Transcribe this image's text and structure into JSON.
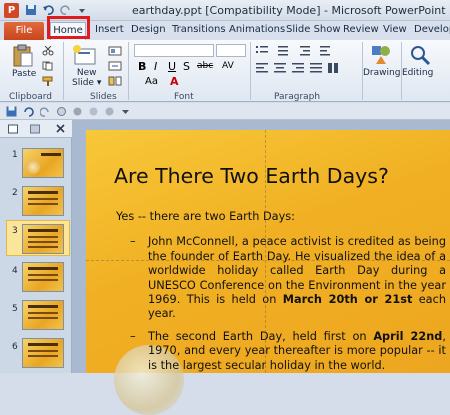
{
  "window": {
    "title": "earthday.ppt [Compatibility Mode] - Microsoft PowerPoint",
    "app_icon_letter": "P"
  },
  "tabs": {
    "file": "File",
    "items": [
      "Home",
      "Insert",
      "Design",
      "Transitions",
      "Animations",
      "Slide Show",
      "Review",
      "View",
      "Develope"
    ]
  },
  "ribbon": {
    "clipboard": {
      "paste": "Paste",
      "label": "Clipboard"
    },
    "slides": {
      "new_slide": "New Slide ▾",
      "new_slide_line1": "New",
      "new_slide_line2": "Slide ▾",
      "label": "Slides"
    },
    "font": {
      "bold": "B",
      "italic": "I",
      "underline": "U",
      "strike": "S",
      "shadow": "abc",
      "spacing": "AV",
      "case": "Aa",
      "color": "A",
      "label": "Font"
    },
    "paragraph": {
      "label": "Paragraph"
    },
    "drawing": {
      "label": "Drawing"
    },
    "editing": {
      "label": "Editing"
    }
  },
  "slide_panel": {
    "thumbnails": [
      "1",
      "2",
      "3",
      "4",
      "5",
      "6"
    ],
    "selected": "3"
  },
  "slide": {
    "title": "Are There Two Earth Days?",
    "bullet1": "Yes -- there are two Earth Days:",
    "sub1_part1": "John McConnell, a peace activist is credited as being the founder of Earth Day. He visualized the idea of a worldwide holiday called Earth Day during a UNESCO Conference on the Environment in the year 1969. This is held on ",
    "sub1_bold": "March 20th or 21st",
    "sub1_part2": " each year.",
    "sub2_part1": "The second Earth Day, held first on ",
    "sub2_bold": "April 22nd",
    "sub2_part2": ", 1970, and every year thereafter is more popular -- it is the largest secular holiday in the world.",
    "dash": "–"
  },
  "colors": {
    "file_tab": "#d24726",
    "highlight": "#e01b1b",
    "slide_bg": "#f1b024"
  }
}
